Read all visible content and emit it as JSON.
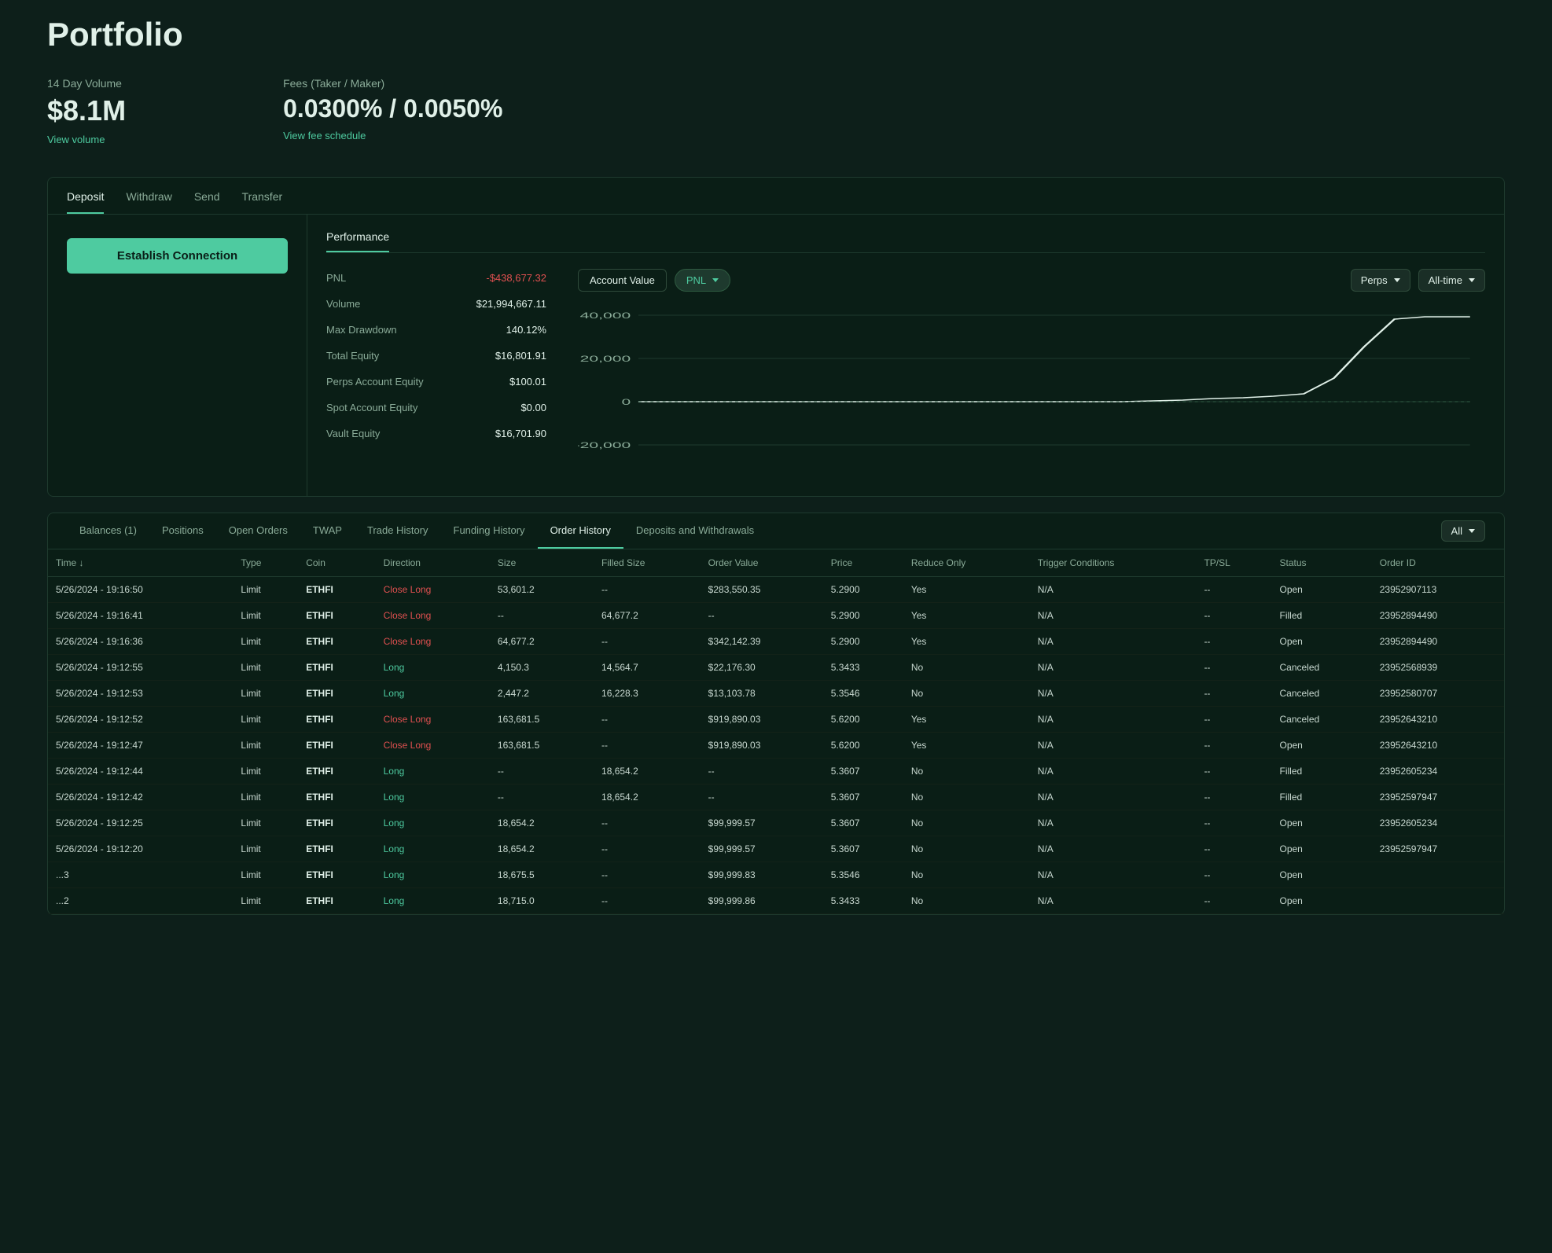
{
  "page": {
    "title": "Portfolio"
  },
  "stats": {
    "volume_label": "14 Day Volume",
    "volume_value": "$8.1M",
    "volume_link": "View volume",
    "fees_label": "Fees (Taker / Maker)",
    "fees_value": "0.0300% / 0.0050%",
    "fees_link": "View fee schedule"
  },
  "top_tabs": [
    {
      "label": "Deposit",
      "active": true
    },
    {
      "label": "Withdraw",
      "active": false
    },
    {
      "label": "Send",
      "active": false
    },
    {
      "label": "Transfer",
      "active": false
    }
  ],
  "establish_btn": "Establish Connection",
  "perf_tabs": [
    {
      "label": "Performance",
      "active": true
    }
  ],
  "perf_stats": [
    {
      "name": "PNL",
      "value": "-$438,677.32",
      "negative": true
    },
    {
      "name": "Volume",
      "value": "$21,994,667.11",
      "negative": false
    },
    {
      "name": "Max Drawdown",
      "value": "140.12%",
      "negative": false
    },
    {
      "name": "Total Equity",
      "value": "$16,801.91",
      "negative": false
    },
    {
      "name": "Perps Account Equity",
      "value": "$100.01",
      "negative": false
    },
    {
      "name": "Spot Account Equity",
      "value": "$0.00",
      "negative": false
    },
    {
      "name": "Vault Equity",
      "value": "$16,701.90",
      "negative": false
    }
  ],
  "chart": {
    "account_value_btn": "Account Value",
    "pnl_btn": "PNL",
    "perps_dropdown": "Perps",
    "alltime_dropdown": "All-time",
    "y_labels": [
      "40,000",
      "20,000",
      "0",
      "-20,000"
    ],
    "y_values": [
      40000,
      20000,
      0,
      -20000
    ]
  },
  "bottom_tabs": [
    {
      "label": "Balances (1)",
      "active": false
    },
    {
      "label": "Positions",
      "active": false
    },
    {
      "label": "Open Orders",
      "active": false
    },
    {
      "label": "TWAP",
      "active": false
    },
    {
      "label": "Trade History",
      "active": false
    },
    {
      "label": "Funding History",
      "active": false
    },
    {
      "label": "Order History",
      "active": true
    },
    {
      "label": "Deposits and Withdrawals",
      "active": false
    }
  ],
  "all_dropdown": "All",
  "table": {
    "columns": [
      {
        "key": "time",
        "label": "Time",
        "sortable": true
      },
      {
        "key": "type",
        "label": "Type"
      },
      {
        "key": "coin",
        "label": "Coin"
      },
      {
        "key": "direction",
        "label": "Direction"
      },
      {
        "key": "size",
        "label": "Size"
      },
      {
        "key": "filled_size",
        "label": "Filled Size"
      },
      {
        "key": "order_value",
        "label": "Order Value"
      },
      {
        "key": "price",
        "label": "Price"
      },
      {
        "key": "reduce_only",
        "label": "Reduce Only"
      },
      {
        "key": "trigger_conditions",
        "label": "Trigger Conditions"
      },
      {
        "key": "tp_sl",
        "label": "TP/SL"
      },
      {
        "key": "status",
        "label": "Status"
      },
      {
        "key": "order_id",
        "label": "Order ID"
      }
    ],
    "rows": [
      {
        "time": "5/26/2024 - 19:16:50",
        "type": "Limit",
        "coin": "ETHFI",
        "direction": "Close Long",
        "direction_type": "close_long",
        "size": "53,601.2",
        "filled_size": "--",
        "order_value": "$283,550.35",
        "price": "5.2900",
        "reduce_only": "Yes",
        "trigger": "N/A",
        "tp_sl": "--",
        "status": "Open",
        "order_id": "23952907113"
      },
      {
        "time": "5/26/2024 - 19:16:41",
        "type": "Limit",
        "coin": "ETHFI",
        "direction": "Close Long",
        "direction_type": "close_long",
        "size": "--",
        "filled_size": "64,677.2",
        "order_value": "--",
        "price": "5.2900",
        "reduce_only": "Yes",
        "trigger": "N/A",
        "tp_sl": "--",
        "status": "Filled",
        "order_id": "23952894490"
      },
      {
        "time": "5/26/2024 - 19:16:36",
        "type": "Limit",
        "coin": "ETHFI",
        "direction": "Close Long",
        "direction_type": "close_long",
        "size": "64,677.2",
        "filled_size": "--",
        "order_value": "$342,142.39",
        "price": "5.2900",
        "reduce_only": "Yes",
        "trigger": "N/A",
        "tp_sl": "--",
        "status": "Open",
        "order_id": "23952894490"
      },
      {
        "time": "5/26/2024 - 19:12:55",
        "type": "Limit",
        "coin": "ETHFI",
        "direction": "Long",
        "direction_type": "long",
        "size": "4,150.3",
        "filled_size": "14,564.7",
        "order_value": "$22,176.30",
        "price": "5.3433",
        "reduce_only": "No",
        "trigger": "N/A",
        "tp_sl": "--",
        "status": "Canceled",
        "order_id": "23952568939"
      },
      {
        "time": "5/26/2024 - 19:12:53",
        "type": "Limit",
        "coin": "ETHFI",
        "direction": "Long",
        "direction_type": "long",
        "size": "2,447.2",
        "filled_size": "16,228.3",
        "order_value": "$13,103.78",
        "price": "5.3546",
        "reduce_only": "No",
        "trigger": "N/A",
        "tp_sl": "--",
        "status": "Canceled",
        "order_id": "23952580707"
      },
      {
        "time": "5/26/2024 - 19:12:52",
        "type": "Limit",
        "coin": "ETHFI",
        "direction": "Close Long",
        "direction_type": "close_long",
        "size": "163,681.5",
        "filled_size": "--",
        "order_value": "$919,890.03",
        "price": "5.6200",
        "reduce_only": "Yes",
        "trigger": "N/A",
        "tp_sl": "--",
        "status": "Canceled",
        "order_id": "23952643210"
      },
      {
        "time": "5/26/2024 - 19:12:47",
        "type": "Limit",
        "coin": "ETHFI",
        "direction": "Close Long",
        "direction_type": "close_long",
        "size": "163,681.5",
        "filled_size": "--",
        "order_value": "$919,890.03",
        "price": "5.6200",
        "reduce_only": "Yes",
        "trigger": "N/A",
        "tp_sl": "--",
        "status": "Open",
        "order_id": "23952643210"
      },
      {
        "time": "5/26/2024 - 19:12:44",
        "type": "Limit",
        "coin": "ETHFI",
        "direction": "Long",
        "direction_type": "long",
        "size": "--",
        "filled_size": "18,654.2",
        "order_value": "--",
        "price": "5.3607",
        "reduce_only": "No",
        "trigger": "N/A",
        "tp_sl": "--",
        "status": "Filled",
        "order_id": "23952605234"
      },
      {
        "time": "5/26/2024 - 19:12:42",
        "type": "Limit",
        "coin": "ETHFI",
        "direction": "Long",
        "direction_type": "long",
        "size": "--",
        "filled_size": "18,654.2",
        "order_value": "--",
        "price": "5.3607",
        "reduce_only": "No",
        "trigger": "N/A",
        "tp_sl": "--",
        "status": "Filled",
        "order_id": "23952597947"
      },
      {
        "time": "5/26/2024 - 19:12:25",
        "type": "Limit",
        "coin": "ETHFI",
        "direction": "Long",
        "direction_type": "long",
        "size": "18,654.2",
        "filled_size": "--",
        "order_value": "$99,999.57",
        "price": "5.3607",
        "reduce_only": "No",
        "trigger": "N/A",
        "tp_sl": "--",
        "status": "Open",
        "order_id": "23952605234"
      },
      {
        "time": "5/26/2024 - 19:12:20",
        "type": "Limit",
        "coin": "ETHFI",
        "direction": "Long",
        "direction_type": "long",
        "size": "18,654.2",
        "filled_size": "--",
        "order_value": "$99,999.57",
        "price": "5.3607",
        "reduce_only": "No",
        "trigger": "N/A",
        "tp_sl": "--",
        "status": "Open",
        "order_id": "23952597947"
      },
      {
        "time": "...3",
        "type": "Limit",
        "coin": "ETHFI",
        "direction": "Long",
        "direction_type": "long",
        "size": "18,675.5",
        "filled_size": "--",
        "order_value": "$99,999.83",
        "price": "5.3546",
        "reduce_only": "No",
        "trigger": "N/A",
        "tp_sl": "--",
        "status": "Open",
        "order_id": ""
      },
      {
        "time": "...2",
        "type": "Limit",
        "coin": "ETHFI",
        "direction": "Long",
        "direction_type": "long",
        "size": "18,715.0",
        "filled_size": "--",
        "order_value": "$99,999.86",
        "price": "5.3433",
        "reduce_only": "No",
        "trigger": "N/A",
        "tp_sl": "--",
        "status": "Open",
        "order_id": ""
      }
    ]
  }
}
